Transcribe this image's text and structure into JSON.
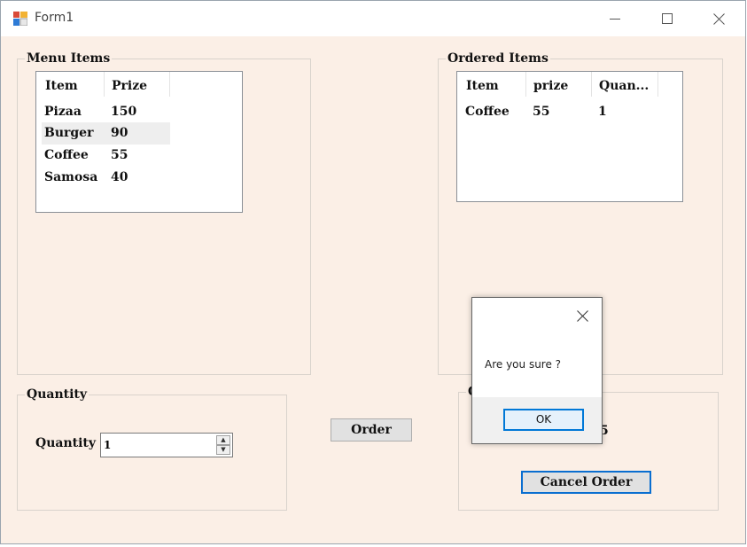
{
  "window": {
    "title": "Form1"
  },
  "menu_group": {
    "legend": "Menu Items",
    "columns": [
      "Item",
      "Prize"
    ],
    "rows": [
      {
        "item": "Pizaa",
        "prize": "150"
      },
      {
        "item": "Burger",
        "prize": "90"
      },
      {
        "item": "Coffee",
        "prize": "55"
      },
      {
        "item": "Samosa",
        "prize": "40"
      }
    ]
  },
  "ordered_group": {
    "legend": "Ordered Items",
    "columns": [
      "Item",
      "prize",
      "Quan..."
    ],
    "rows": [
      {
        "item": "Coffee",
        "prize": "55",
        "quantity": "1"
      }
    ]
  },
  "quantity_group": {
    "legend": "Quantity",
    "label": "Quantity",
    "value": "1"
  },
  "order_button": "Order",
  "total_group": {
    "legend_partial": "C",
    "value_partial": "5",
    "cancel_button": "Cancel Order"
  },
  "dialog": {
    "message": "Are you sure ?",
    "ok_button": "OK"
  },
  "colors": {
    "form_bg": "#fbefe6",
    "accent": "#0078d7"
  }
}
